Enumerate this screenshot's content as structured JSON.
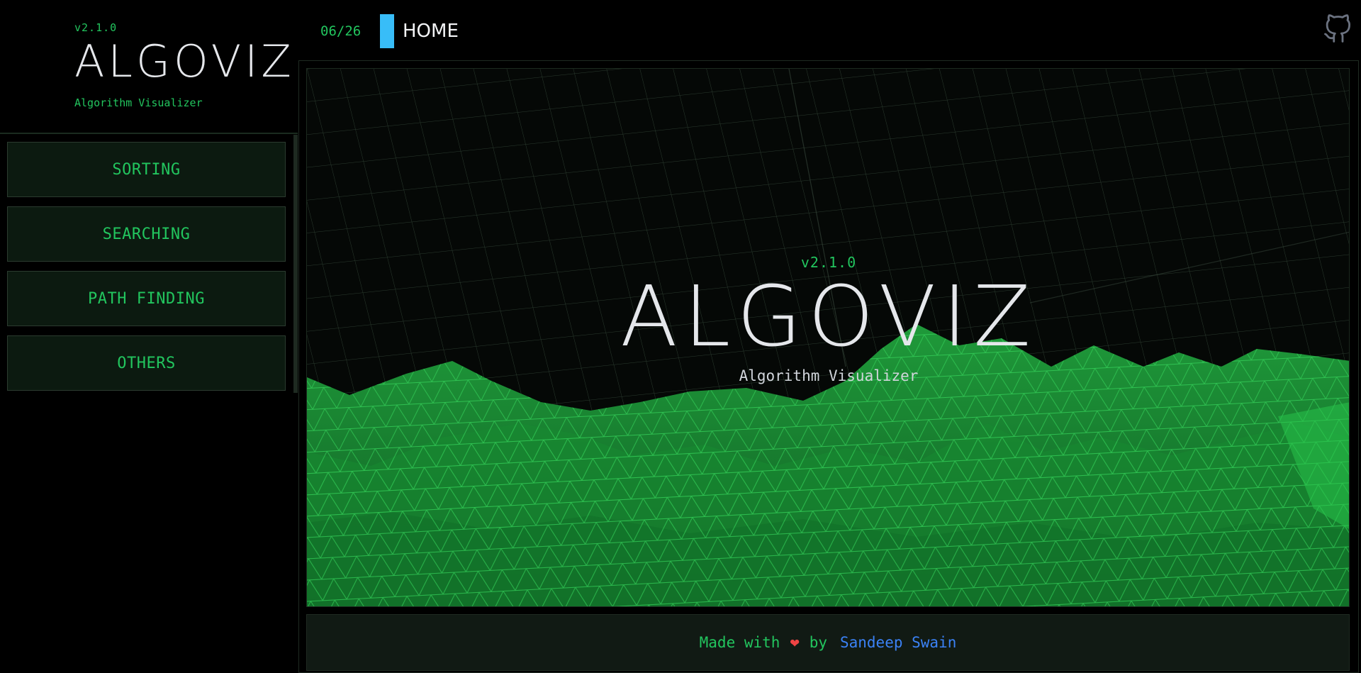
{
  "brand": {
    "version": "v2.1.0",
    "title": "ALGOVIZ",
    "subtitle": "Algorithm Visualizer"
  },
  "nav": {
    "items": [
      {
        "label": "SORTING"
      },
      {
        "label": "SEARCHING"
      },
      {
        "label": "PATH FINDING"
      },
      {
        "label": "OTHERS"
      }
    ]
  },
  "header": {
    "page_count": "06/26",
    "page_title": "HOME",
    "github_icon": "github-icon"
  },
  "hero": {
    "version": "v2.1.0",
    "title": "ALGOVIZ",
    "subtitle": "Algorithm Visualizer"
  },
  "footer": {
    "made_with": "Made with",
    "heart": "❤",
    "by": "by",
    "author": "Sandeep Swain"
  },
  "colors": {
    "accent_green": "#22c55e",
    "accent_blue": "#38bdf8",
    "link_blue": "#3b82f6",
    "heart_red": "#ef4444",
    "background": "#000000"
  }
}
